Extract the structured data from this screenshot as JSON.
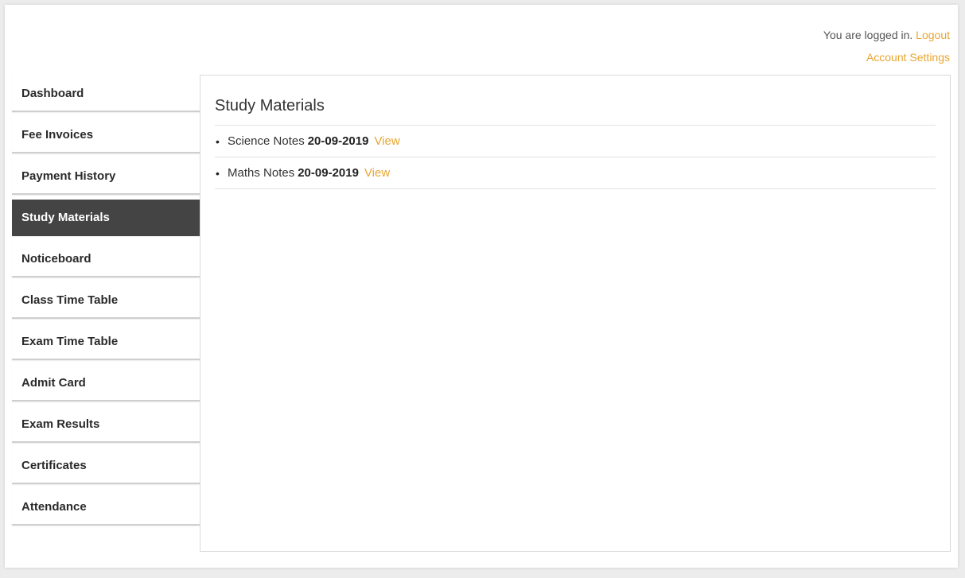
{
  "header": {
    "logged_in_text": "You are logged in.",
    "logout_label": "Logout",
    "account_settings_label": "Account Settings"
  },
  "sidebar": {
    "items": [
      {
        "label": "Dashboard"
      },
      {
        "label": "Fee Invoices"
      },
      {
        "label": "Payment History"
      },
      {
        "label": "Study Materials",
        "active": true
      },
      {
        "label": "Noticeboard"
      },
      {
        "label": "Class Time Table"
      },
      {
        "label": "Exam Time Table"
      },
      {
        "label": "Admit Card"
      },
      {
        "label": "Exam Results"
      },
      {
        "label": "Certificates"
      },
      {
        "label": "Attendance"
      }
    ]
  },
  "main": {
    "title": "Study Materials",
    "materials": [
      {
        "name": "Science Notes",
        "date": "20-09-2019",
        "action": "View"
      },
      {
        "name": "Maths Notes",
        "date": "20-09-2019",
        "action": "View"
      }
    ]
  },
  "colors": {
    "accent": "#e8a531",
    "active_nav_bg": "#444444"
  }
}
